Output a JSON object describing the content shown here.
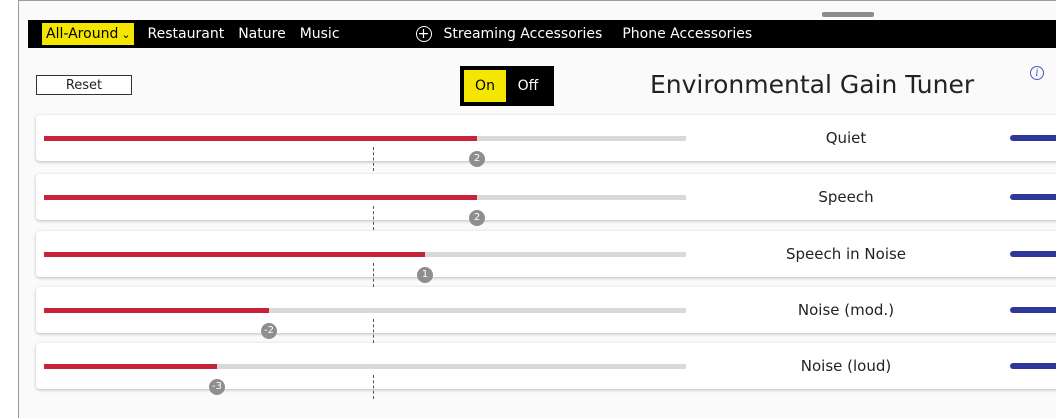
{
  "topbar": {
    "presets": [
      "All-Around",
      "Restaurant",
      "Nature",
      "Music"
    ],
    "active_preset": "All-Around",
    "accessories": [
      "Streaming Accessories",
      "Phone Accessories"
    ]
  },
  "controls": {
    "reset_label": "Reset",
    "toggle_on": "On",
    "toggle_off": "Off",
    "title": "Environmental Gain Tuner"
  },
  "sliders": [
    {
      "label": "Quiet",
      "value": 2,
      "knob": "2"
    },
    {
      "label": "Speech",
      "value": 2,
      "knob": "2"
    },
    {
      "label": "Speech in Noise",
      "value": 1,
      "knob": "1"
    },
    {
      "label": "Noise (mod.)",
      "value": -2,
      "knob": "-2"
    },
    {
      "label": "Noise (loud)",
      "value": -3,
      "knob": "-3"
    }
  ],
  "colors": {
    "accent_yellow": "#f5e600",
    "slider_fill": "#c7233b",
    "right_bar": "#2e3899"
  }
}
